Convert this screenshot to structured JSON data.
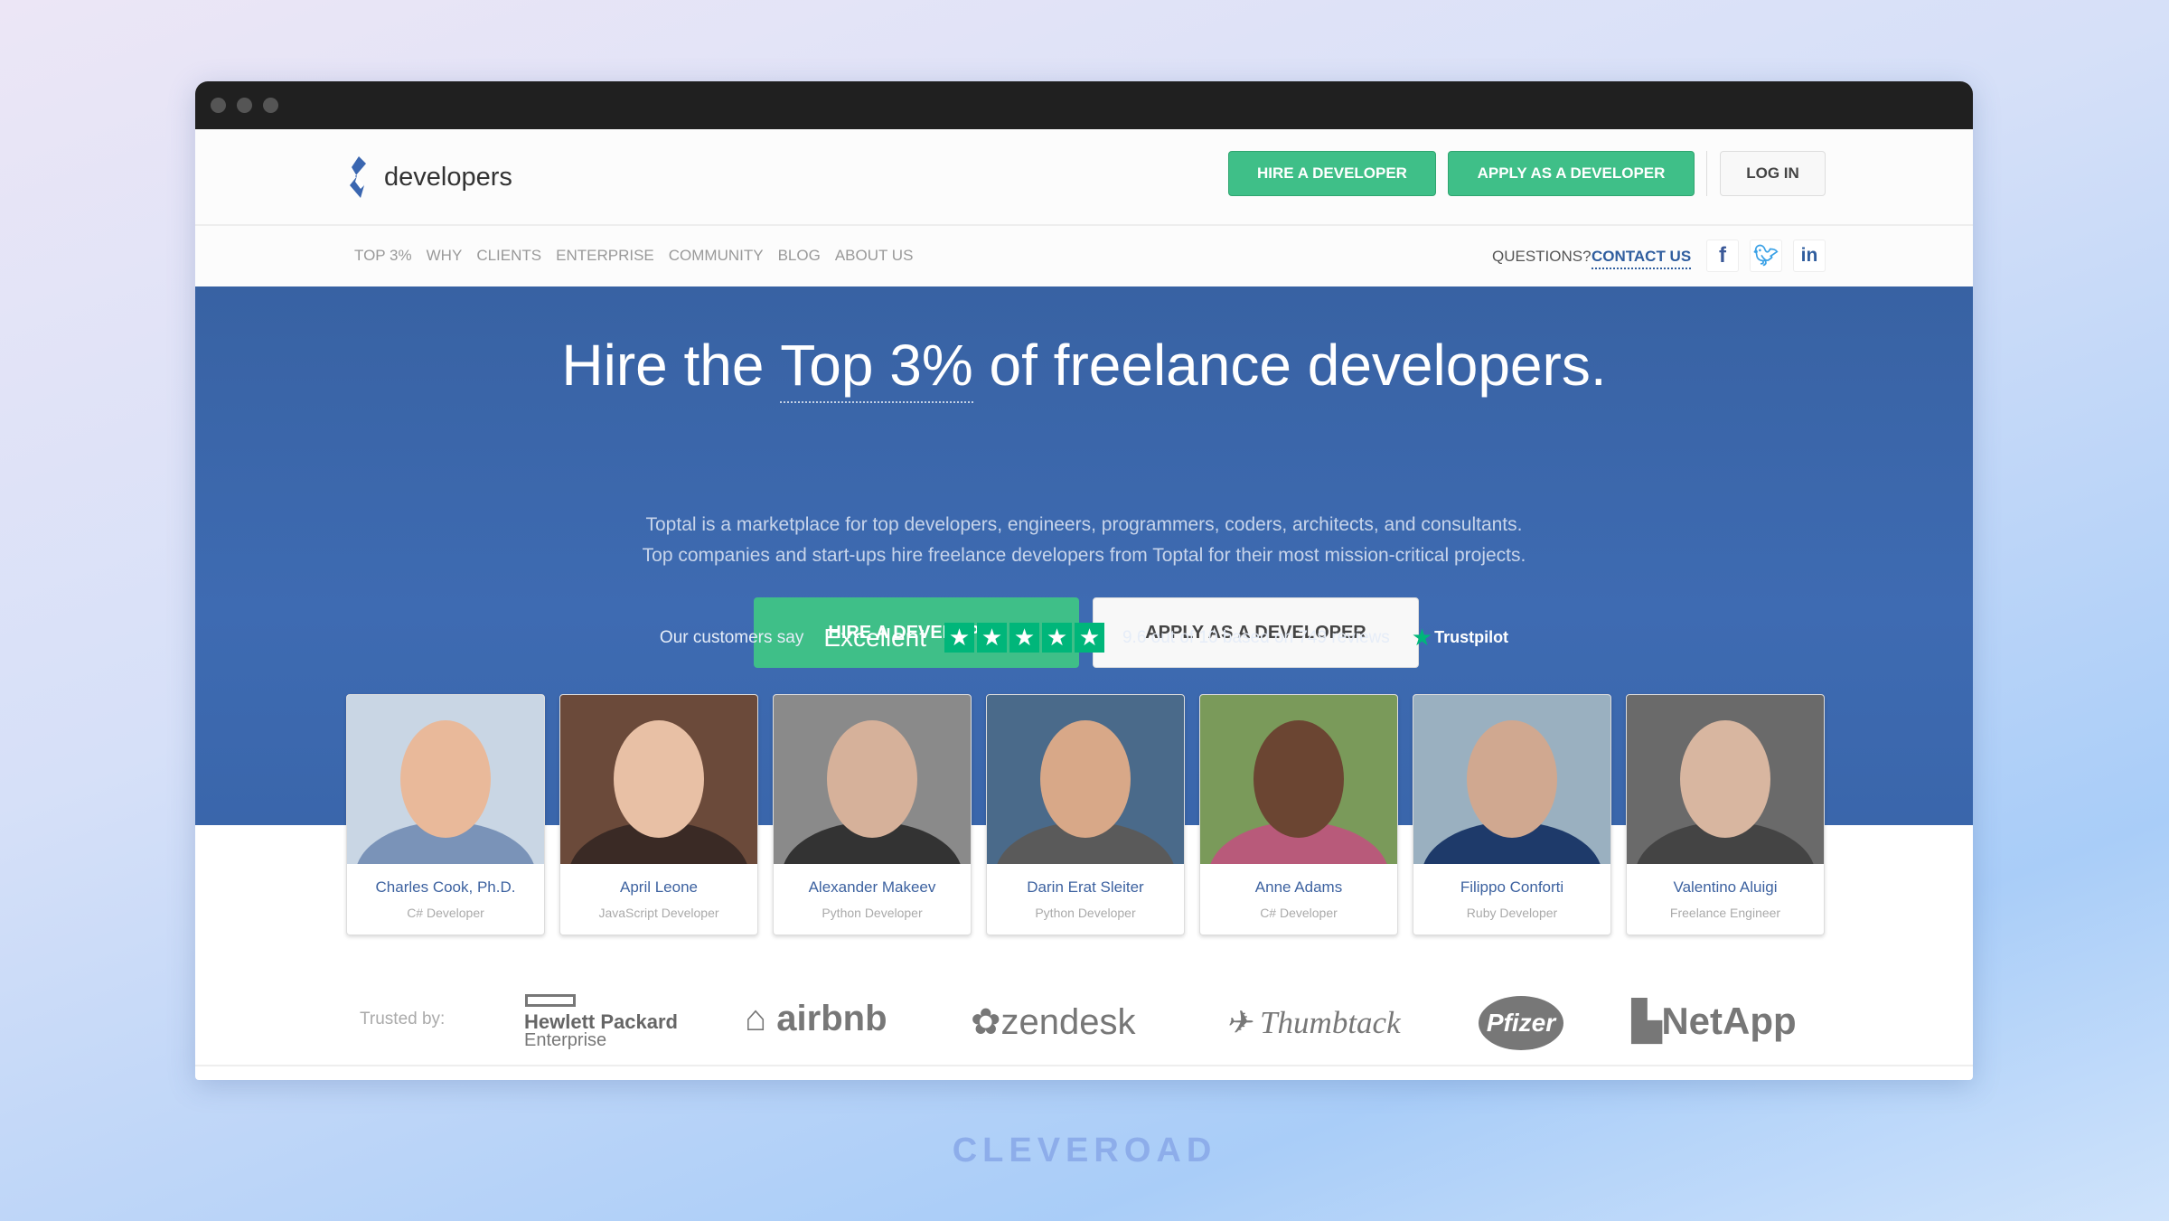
{
  "header": {
    "logo_text": "developers",
    "hire_label": "HIRE A DEVELOPER",
    "apply_label": "APPLY AS A DEVELOPER",
    "login_label": "LOG IN"
  },
  "nav": {
    "items": [
      "TOP 3%",
      "WHY",
      "CLIENTS",
      "ENTERPRISE",
      "COMMUNITY",
      "BLOG",
      "ABOUT US"
    ],
    "questions": "QUESTIONS?",
    "contact": "CONTACT US",
    "social": [
      "facebook-icon",
      "twitter-icon",
      "linkedin-icon"
    ]
  },
  "hero": {
    "h1": "Hire the ",
    "h2": "Top 3%",
    "h3": " of freelance ",
    "h4": "developers",
    "h5": ".",
    "sub1": "Toptal is a marketplace for top developers, engineers, programmers, coders, architects, and consultants.",
    "sub2": "Top companies and start-ups hire freelance developers from Toptal for their most mission-critical projects.",
    "hire_label": "HIRE A DEVELOPER",
    "apply_label": "APPLY AS A DEVELOPER"
  },
  "trustpilot": {
    "prefix": "Our customers say",
    "rating_word": "Excellent",
    "stars": 5,
    "summary": "9.6 out of 10 based on 749 reviews",
    "brand": "Trustpilot"
  },
  "developers": [
    {
      "name": "Charles Cook, Ph.D.",
      "role": "C# Developer"
    },
    {
      "name": "April Leone",
      "role": "JavaScript Developer"
    },
    {
      "name": "Alexander Makeev",
      "role": "Python Developer"
    },
    {
      "name": "Darin Erat Sleiter",
      "role": "Python Developer"
    },
    {
      "name": "Anne Adams",
      "role": "C# Developer"
    },
    {
      "name": "Filippo Conforti",
      "role": "Ruby Developer"
    },
    {
      "name": "Valentino Aluigi",
      "role": "Freelance Engineer"
    }
  ],
  "trusted": {
    "label": "Trusted by:",
    "brands": [
      "Hewlett Packard",
      "Enterprise",
      "airbnb",
      "zendesk",
      "Thumbtack",
      "Pfizer",
      "NetApp"
    ]
  },
  "watermark": "CLEVEROAD",
  "colors": {
    "green": "#3fbf88",
    "hero_blue": "#3b65a8",
    "link_blue": "#2f5d9e",
    "trustpilot_green": "#00b67a"
  }
}
